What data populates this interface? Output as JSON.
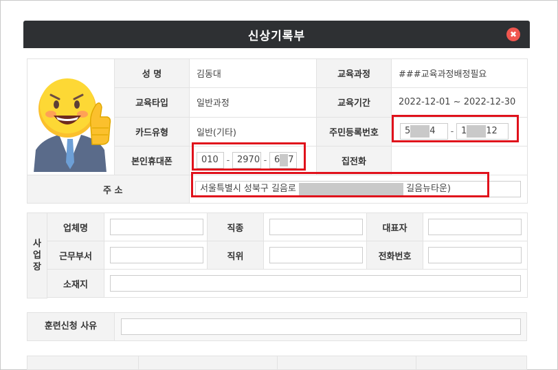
{
  "dialog": {
    "title": "신상기록부",
    "close_icon": "close-icon"
  },
  "profile": {
    "name_label": "성 명",
    "name": "김동대",
    "course_label": "교육과정",
    "course": "###교육과정배정필요",
    "type_label": "교육타입",
    "type": "일반과정",
    "period_label": "교육기간",
    "period": "2022-12-01 ~ 2022-12-30",
    "card_label": "카드유형",
    "card": "일반(기타)",
    "rrn_label": "주민등록번호",
    "rrn_front_a": "5",
    "rrn_front_b": "4",
    "rrn_back_a": "1",
    "rrn_back_b": "12",
    "mobile_label": "본인휴대폰",
    "mobile_1": "010",
    "mobile_2": "2970",
    "mobile_3a": "6",
    "mobile_3b": "7",
    "homephone_label": "집전화",
    "address_label": "주 소",
    "address_a": "서울특별시 성북구 길음로",
    "address_b": "길음뉴타운)"
  },
  "workplace": {
    "side_label_1": "사",
    "side_label_2": "업",
    "side_label_3": "장",
    "company_label": "업체명",
    "job_label": "직종",
    "ceo_label": "대표자",
    "dept_label": "근무부서",
    "position_label": "직위",
    "phone_label": "전화번호",
    "location_label": "소재지"
  },
  "reason": {
    "label": "훈련신청 사유"
  }
}
